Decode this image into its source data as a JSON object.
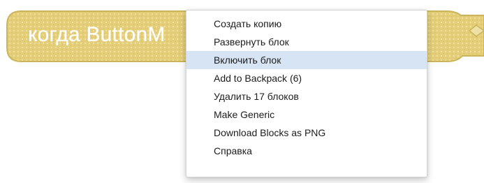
{
  "block": {
    "label": "когда ButtonM",
    "color": "#e6d07a",
    "border_color": "#cbb45a"
  },
  "context_menu": {
    "highlight_color": "#d6e4f3",
    "items": [
      {
        "label": "Создать копию",
        "highlighted": false
      },
      {
        "label": "Развернуть блок",
        "highlighted": false
      },
      {
        "label": "Включить блок",
        "highlighted": true
      },
      {
        "label": "Add to Backpack (6)",
        "highlighted": false
      },
      {
        "label": "Удалить 17 блоков",
        "highlighted": false
      },
      {
        "label": "Make Generic",
        "highlighted": false
      },
      {
        "label": "Download Blocks as PNG",
        "highlighted": false
      },
      {
        "label": "Справка",
        "highlighted": false
      }
    ]
  }
}
